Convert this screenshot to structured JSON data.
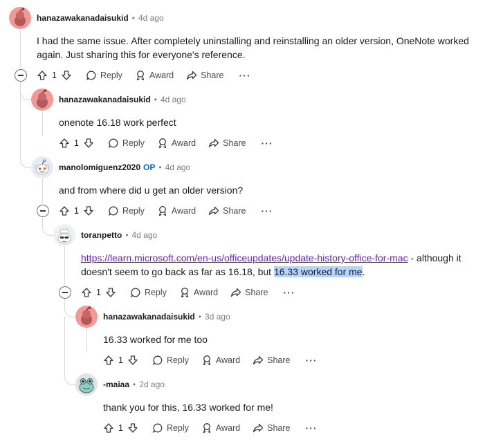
{
  "comments": [
    {
      "author": "hanazawakanadaisukid",
      "time": "4d ago",
      "body_lines": [
        "I had the same issue. After completely uninstalling and reinstalling an older version, OneNote worked",
        "again. Just sharing this for everyone's reference."
      ],
      "votes": "1",
      "avatar": "pink-snoo-avatar-icon"
    },
    {
      "author": "hanazawakanadaisukid",
      "time": "4d ago",
      "body": "onenote 16.18 work perfect",
      "votes": "1",
      "avatar": "pink-snoo-avatar-icon"
    },
    {
      "author": "manolomiguenz2020",
      "op_badge": "OP",
      "time": "4d ago",
      "body": "and from where did u get an older version?",
      "votes": "1",
      "avatar": "default-snoo-avatar-icon"
    },
    {
      "author": "toranpetto",
      "time": "4d ago",
      "link": "https://learn.microsoft.com/en-us/officeupdates/update-history-office-for-mac",
      "body_after_link": " - although it",
      "body_line2_pre": "doesn't seem to go back as far as 16.18, but ",
      "body_line2_highlight": "16.33 worked for me",
      "body_line2_post": ".",
      "votes": "1",
      "avatar": "chef-snoo-avatar-icon"
    },
    {
      "author": "hanazawakanadaisukid",
      "time": "3d ago",
      "body": "16.33 worked for me too",
      "votes": "1",
      "avatar": "pink-snoo-avatar-icon"
    },
    {
      "author": "-maiaa",
      "time": "2d ago",
      "body": "thank you for this, 16.33 worked for me!",
      "votes": "1",
      "avatar": "frog-avatar-icon"
    }
  ],
  "actions": {
    "reply": "Reply",
    "award": "Award",
    "share": "Share",
    "more": "···"
  },
  "colors": {
    "link": "#6b20c7",
    "op": "#0a66d6",
    "highlight": "#b4d5fe",
    "avatar_pink": "#f49797",
    "thread_line": "#d7dadc"
  }
}
